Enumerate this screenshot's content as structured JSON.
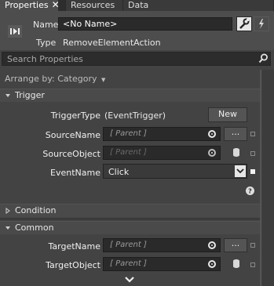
{
  "tabs": [
    {
      "label": "Properties"
    },
    {
      "label": "Resources"
    },
    {
      "label": "Data"
    }
  ],
  "header": {
    "name_label": "Name",
    "name_value": "<No Name>",
    "type_label": "Type",
    "type_value": "RemoveElementAction"
  },
  "search": {
    "placeholder": "Search Properties"
  },
  "arrange": {
    "label": "Arrange by: Category"
  },
  "sections": {
    "trigger": {
      "title": "Trigger",
      "trigger_type_label": "TriggerType",
      "trigger_type_value": "(EventTrigger)",
      "new_button": "New",
      "source_name_label": "SourceName",
      "source_name_value": "[ Parent ]",
      "source_object_label": "SourceObject",
      "source_object_value": "[ Parent ]",
      "event_name_label": "EventName",
      "event_name_value": "Click",
      "ellipsis": "..."
    },
    "condition": {
      "title": "Condition"
    },
    "common": {
      "title": "Common",
      "target_name_label": "TargetName",
      "target_name_value": "[ Parent ]",
      "target_object_label": "TargetObject",
      "target_object_value": "[ Parent ]",
      "ellipsis": "..."
    }
  },
  "icons": [
    "close-icon",
    "element-icon",
    "wrench-icon",
    "lightning-icon",
    "search-icon",
    "chevron-down-icon",
    "triangle-down-icon",
    "triangle-right-icon",
    "dot-icon",
    "cylinder-icon",
    "help-icon"
  ]
}
